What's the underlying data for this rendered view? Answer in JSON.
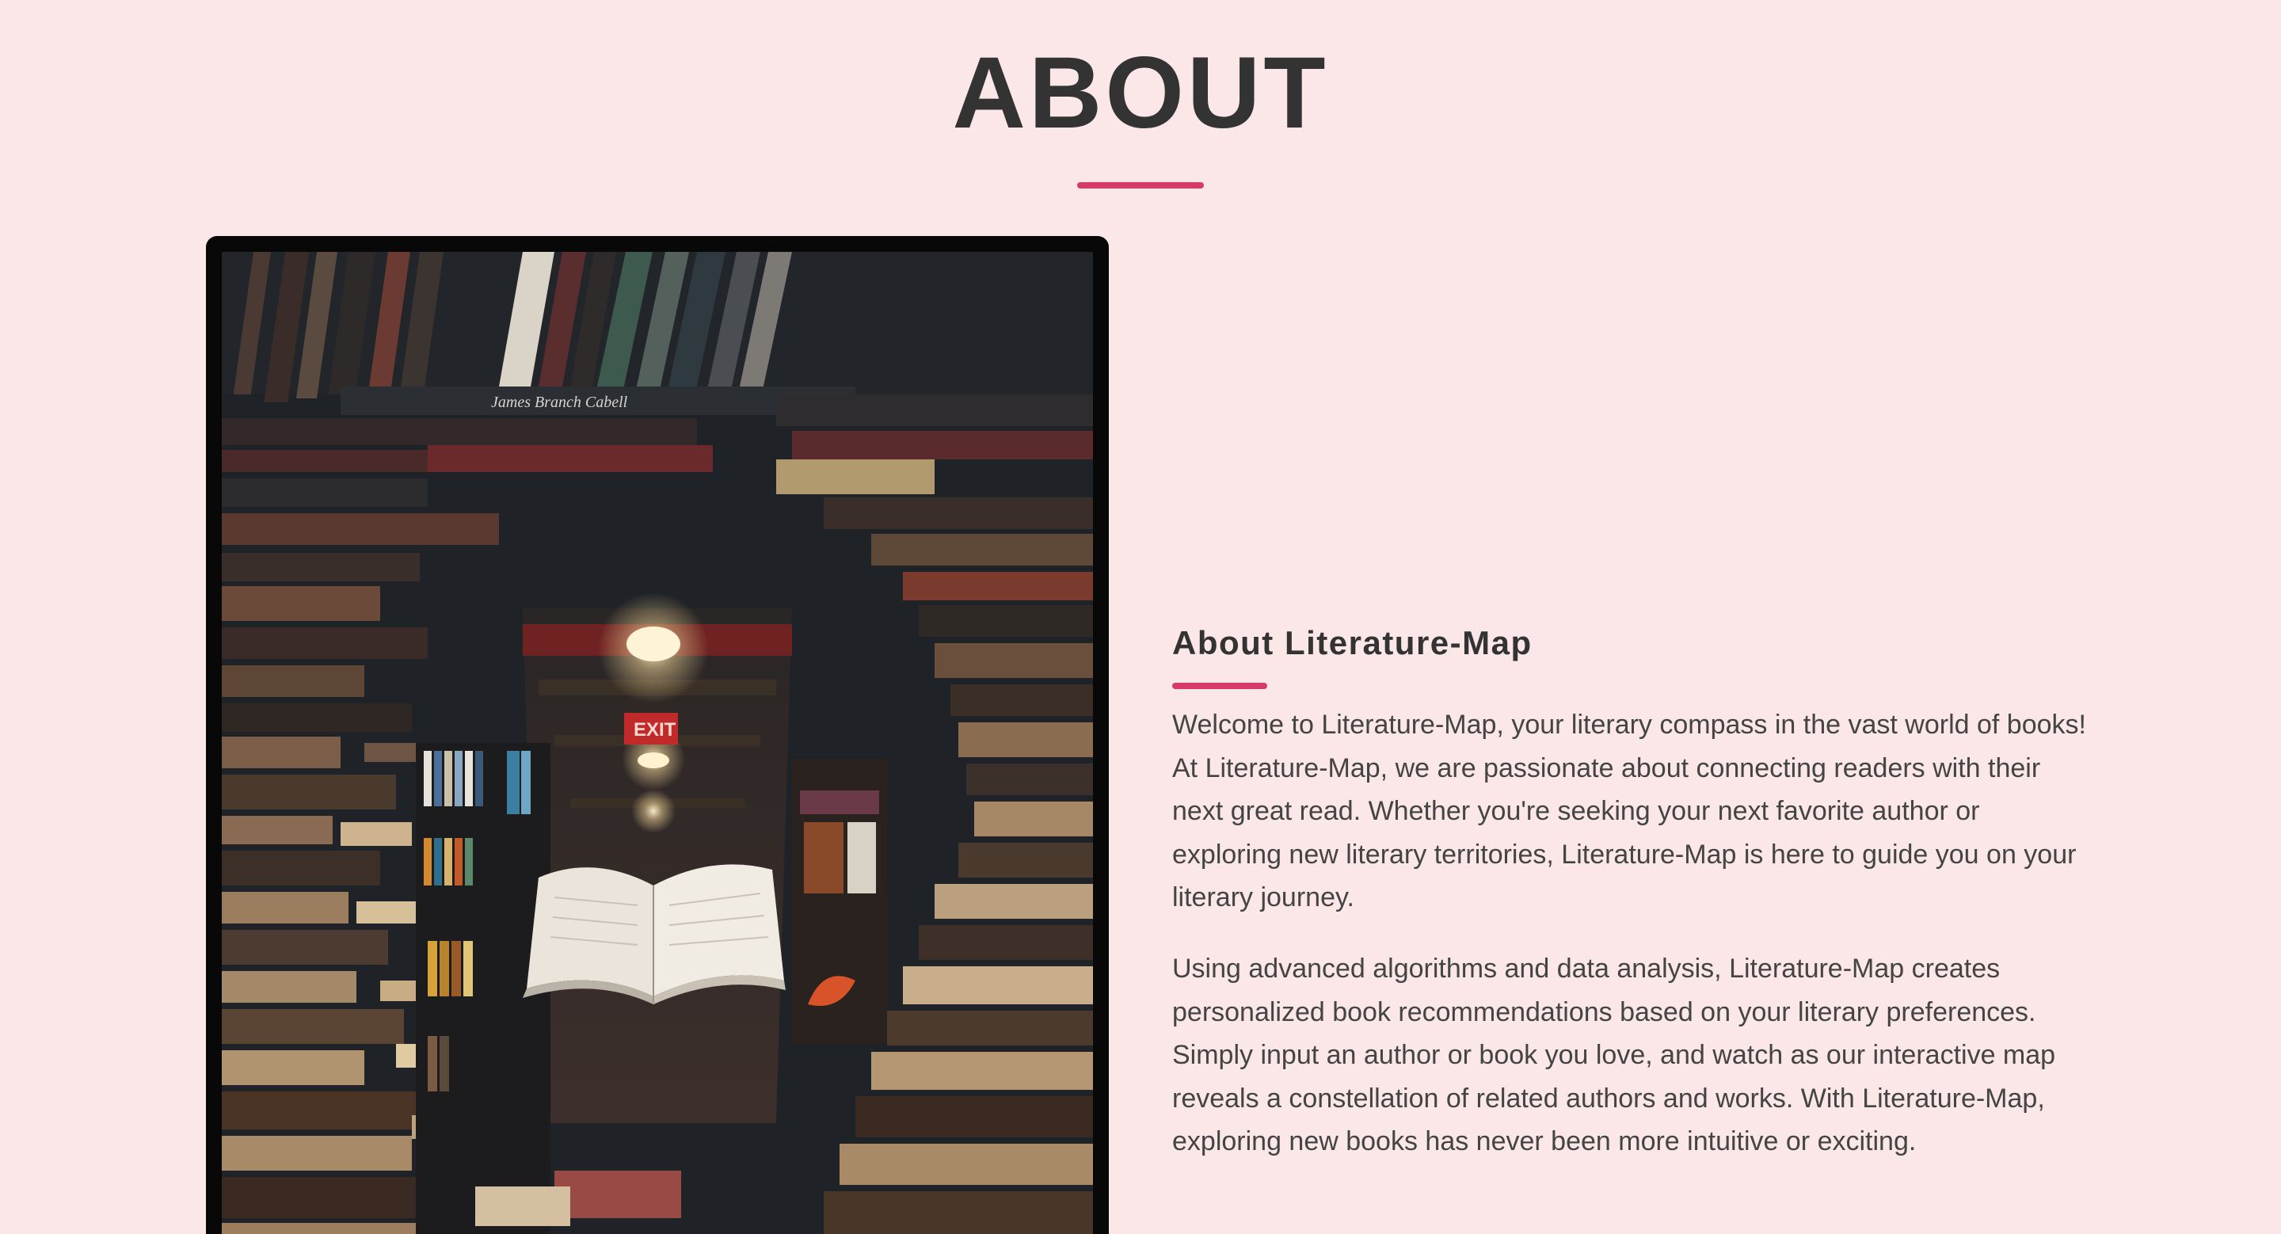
{
  "section": {
    "title": "ABOUT",
    "accent_color": "#d63a6b",
    "background_color": "#fbe7e8"
  },
  "image": {
    "subject": "library-photo-floating-book",
    "spine_text": "James Branch Cabell",
    "exit_sign": "EXIT"
  },
  "about": {
    "heading": "About Literature-Map",
    "paragraphs": [
      "Welcome to Literature-Map, your literary compass in the vast world of books! At Literature-Map, we are passionate about connecting readers with their next great read. Whether you're seeking your next favorite author or exploring new literary territories, Literature-Map is here to guide you on your literary journey.",
      "Using advanced algorithms and data analysis, Literature-Map creates personalized book recommendations based on your literary preferences. Simply input an author or book you love, and watch as our interactive map reveals a constellation of related authors and works. With Literature-Map, exploring new books has never been more intuitive or exciting."
    ]
  }
}
